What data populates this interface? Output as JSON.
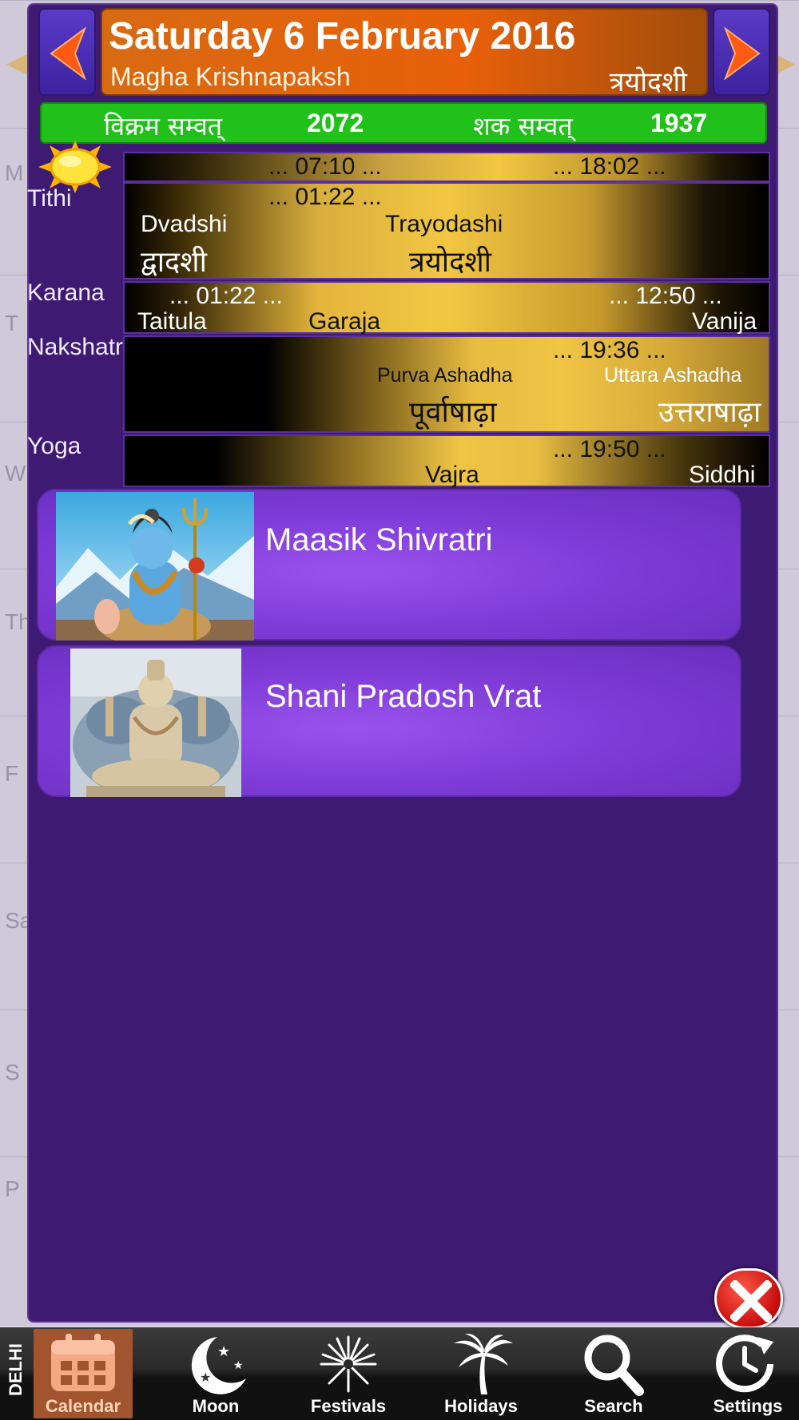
{
  "header": {
    "date": "Saturday 6 February 2016",
    "paksh": "Magha Krishnapaksh",
    "tithi_hindi": "त्रयोदशी"
  },
  "samvat": {
    "vikram_label": "विक्रम सम्वत्",
    "vikram_value": "2072",
    "shaka_label": "शक सम्वत्",
    "shaka_value": "1937"
  },
  "sun": {
    "sunrise": "... 07:10 ...",
    "sunset": "... 18:02 ..."
  },
  "tithi": {
    "label": "Tithi",
    "change_time": "... 01:22 ...",
    "first_name": "Dvadshi",
    "first_hindi": "द्वादशी",
    "second_name": "Trayodashi",
    "second_hindi": "त्रयोदशी"
  },
  "karana": {
    "label": "Karana",
    "time1": "... 01:22 ...",
    "time2": "... 12:50 ...",
    "name1": "Taitula",
    "name2": "Garaja",
    "name3": "Vanija"
  },
  "nakshatra": {
    "label": "Nakshatra",
    "change_time": "... 19:36 ...",
    "first_name": "Purva Ashadha",
    "first_hindi": "पूर्वाषाढ़ा",
    "second_name": "Uttara Ashadha",
    "second_hindi": "उत्तराषाढ़ा"
  },
  "yoga": {
    "label": "Yoga",
    "change_time": "... 19:50 ...",
    "first_name": "Vajra",
    "second_name": "Siddhi"
  },
  "events": [
    {
      "title": "Maasik Shivratri"
    },
    {
      "title": "Shani Pradosh Vrat"
    }
  ],
  "background_letters": [
    "M",
    "T",
    "W",
    "Th",
    "F",
    "Sa",
    "S",
    "P"
  ],
  "tabbar": {
    "city": "DELHI",
    "tabs": [
      {
        "label": "Calendar",
        "icon": "calendar-icon"
      },
      {
        "label": "Moon",
        "icon": "moon-icon"
      },
      {
        "label": "Festivals",
        "icon": "fireworks-icon"
      },
      {
        "label": "Holidays",
        "icon": "palm-tree-icon"
      },
      {
        "label": "Search",
        "icon": "search-icon"
      },
      {
        "label": "Settings",
        "icon": "settings-clock-icon"
      }
    ],
    "active_tab": "Calendar"
  },
  "colors": {
    "panel": "#3f1a73",
    "title_orange": "#e8600a",
    "samvat_green": "#22c01a",
    "event_purple": "#7e3bd6",
    "close_red": "#c80c0c",
    "active_tab": "#a2542e"
  }
}
